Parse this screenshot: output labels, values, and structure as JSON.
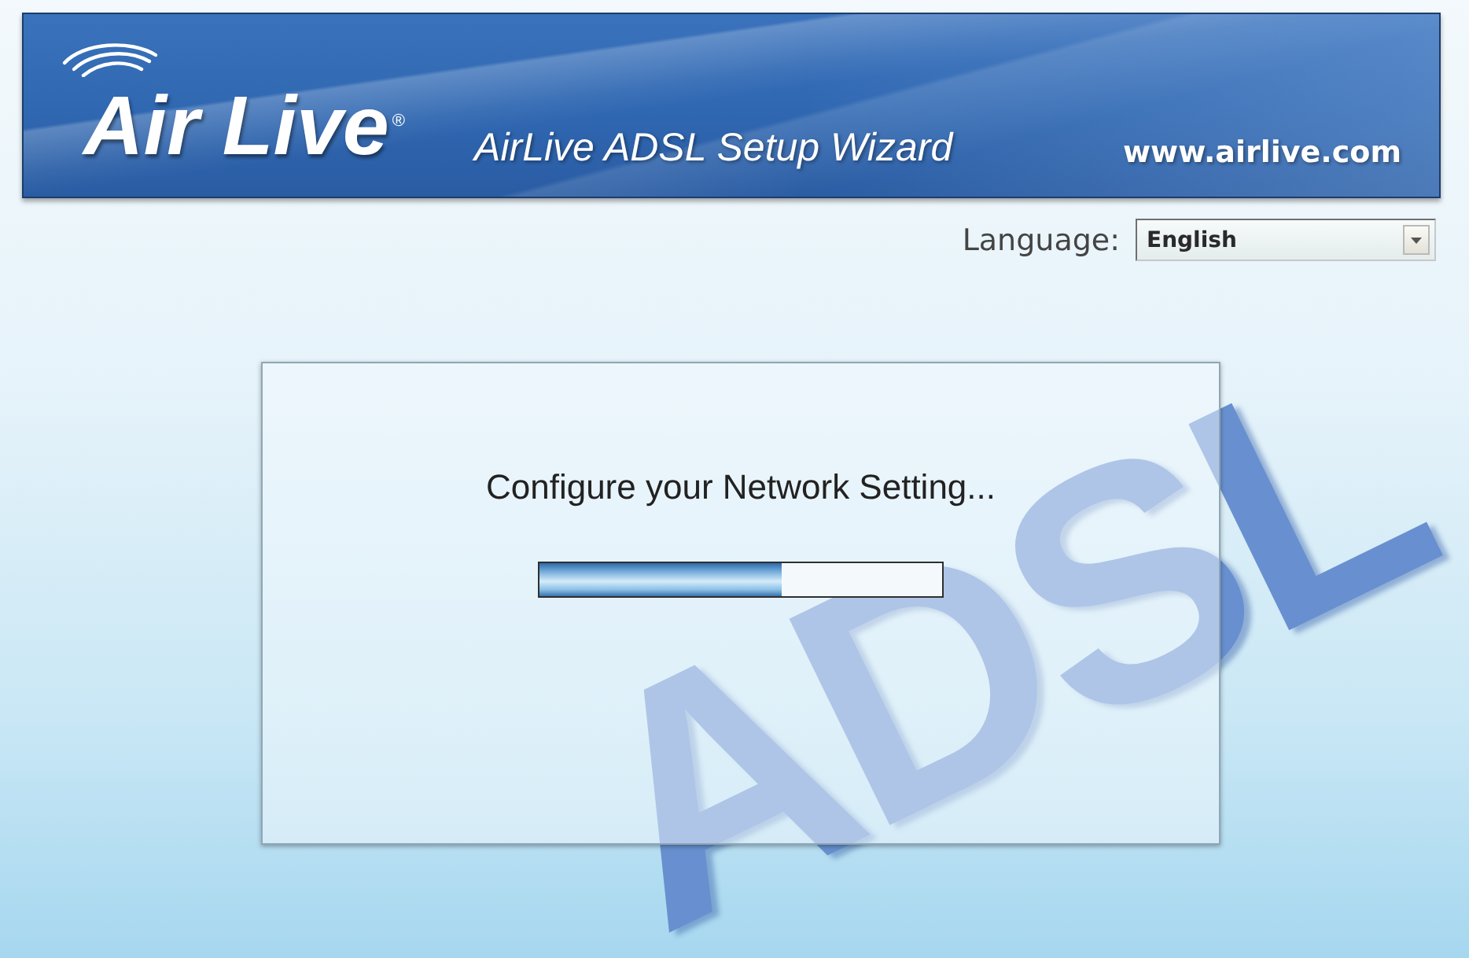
{
  "header": {
    "logo": {
      "text": "Air Live",
      "mark": "®"
    },
    "title": "AirLive ADSL Setup Wizard",
    "website": "www.airlive.com"
  },
  "language": {
    "label": "Language:",
    "value": "English"
  },
  "background_text": "ADSL",
  "dialog": {
    "message": "Configure your Network Setting...",
    "progress": {
      "level": 0.6
    }
  }
}
